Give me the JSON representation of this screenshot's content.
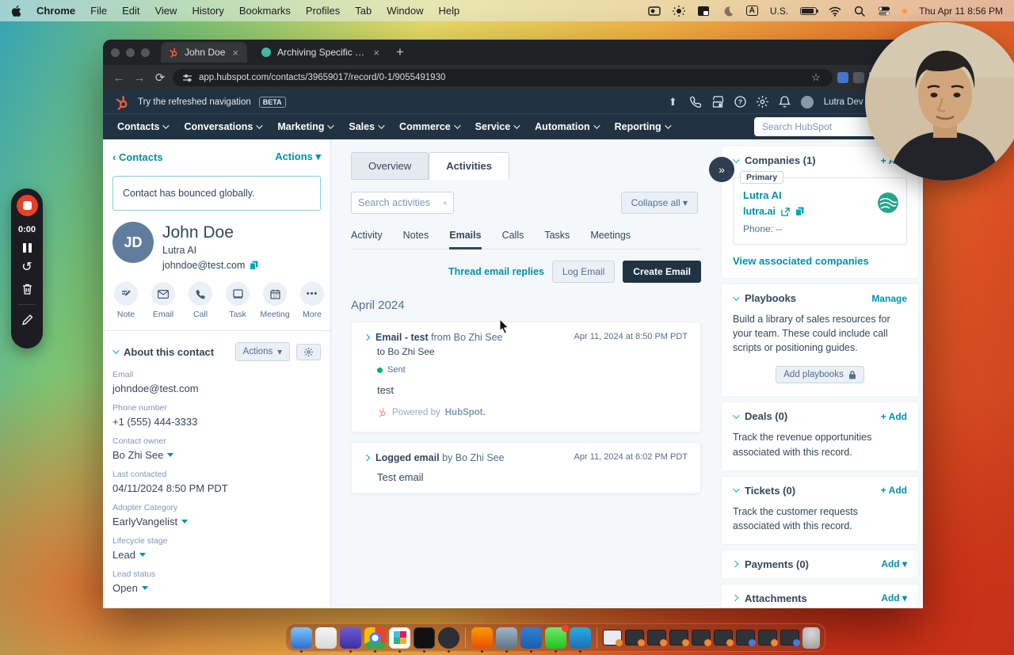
{
  "menubar": {
    "app": "Chrome",
    "items": [
      "File",
      "Edit",
      "View",
      "History",
      "Bookmarks",
      "Profiles",
      "Tab",
      "Window",
      "Help"
    ],
    "input_source": "U.S.",
    "clock": "Thu Apr 11  8:56 PM"
  },
  "recorder": {
    "timer": "0:00"
  },
  "browser": {
    "tabs": [
      {
        "title": "John Doe"
      },
      {
        "title": "Archiving Specific Sender Em"
      }
    ],
    "url": "app.hubspot.com/contacts/39659017/record/0-1/9055491930"
  },
  "hubspot": {
    "topbar": {
      "promo": "Try the refreshed navigation",
      "beta": "BETA",
      "account": "Lutra Dev Playground"
    },
    "nav": [
      "Contacts",
      "Conversations",
      "Marketing",
      "Sales",
      "Commerce",
      "Service",
      "Automation",
      "Reporting"
    ],
    "search_placeholder": "Search HubSpot"
  },
  "left_panel": {
    "back_link": "Contacts",
    "actions_label": "Actions",
    "banner": "Contact has bounced globally.",
    "avatar_initials": "JD",
    "name": "John Doe",
    "company": "Lutra AI",
    "email": "johndoe@test.com",
    "quick_actions": [
      "Note",
      "Email",
      "Call",
      "Task",
      "Meeting",
      "More"
    ],
    "about": {
      "title": "About this contact",
      "actions_label": "Actions",
      "fields": [
        {
          "label": "Email",
          "value": "johndoe@test.com",
          "dropdown": false
        },
        {
          "label": "Phone number",
          "value": "+1 (555) 444-3333",
          "dropdown": false
        },
        {
          "label": "Contact owner",
          "value": "Bo Zhi See",
          "dropdown": true
        },
        {
          "label": "Last contacted",
          "value": "04/11/2024 8:50 PM PDT",
          "dropdown": false
        },
        {
          "label": "Adopter Category",
          "value": "EarlyVangelist",
          "dropdown": true
        },
        {
          "label": "Lifecycle stage",
          "value": "Lead",
          "dropdown": true
        },
        {
          "label": "Lead status",
          "value": "Open",
          "dropdown": true
        }
      ]
    }
  },
  "center_panel": {
    "tabs": [
      "Overview",
      "Activities"
    ],
    "search_placeholder": "Search activities",
    "collapse_all": "Collapse all",
    "subtabs": [
      "Activity",
      "Notes",
      "Emails",
      "Calls",
      "Tasks",
      "Meetings"
    ],
    "active_subtab": "Emails",
    "thread_link": "Thread email replies",
    "log_email": "Log Email",
    "create_email": "Create Email",
    "month_header": "April 2024",
    "emails": [
      {
        "title": "Email - test",
        "from": "from Bo Zhi See",
        "to": "to Bo Zhi See",
        "status": "Sent",
        "body": "test",
        "powered_prefix": "Powered by",
        "powered_brand": "HubSpot.",
        "timestamp": "Apr 11, 2024 at 8:50 PM PDT"
      },
      {
        "title": "Logged email",
        "from": "by Bo Zhi See",
        "body": "Test email",
        "timestamp": "Apr 11, 2024 at 6:02 PM PDT"
      }
    ]
  },
  "right_panel": {
    "companies": {
      "title": "Companies (1)",
      "add": "+ Add",
      "primary": "Primary",
      "name": "Lutra AI",
      "domain": "lutra.ai",
      "phone": "Phone: --",
      "view_link": "View associated companies"
    },
    "playbooks": {
      "title": "Playbooks",
      "manage": "Manage",
      "description": "Build a library of sales resources for your team. These could include call scripts or positioning guides.",
      "button": "Add playbooks"
    },
    "deals": {
      "title": "Deals (0)",
      "add": "+ Add",
      "description": "Track the revenue opportunities associated with this record."
    },
    "tickets": {
      "title": "Tickets (0)",
      "add": "+ Add",
      "description": "Track the customer requests associated with this record."
    },
    "payments": {
      "title": "Payments (0)",
      "add": "Add"
    },
    "attachments": {
      "title": "Attachments",
      "add": "Add"
    }
  },
  "dock": {
    "items": [
      "Finder",
      "Launchpad",
      "1Password",
      "Chrome",
      "Slack",
      "Terminal",
      "Loom",
      "Sublime Text",
      "Screen Share",
      "Outlook",
      "Messages",
      "VS Code",
      "Trash"
    ]
  },
  "colors": {
    "accent": "#0091ae",
    "navy": "#213343",
    "orange": "#ff5c35",
    "green": "#00bda5",
    "bg": "#f5f8fa"
  }
}
